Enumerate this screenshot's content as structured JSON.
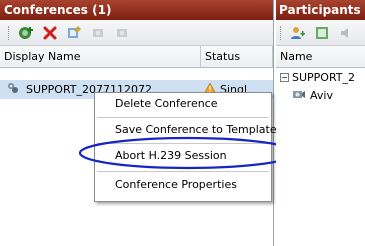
{
  "conferences_panel": {
    "title": "Conferences (1)",
    "columns": [
      "Display Name",
      "Status"
    ],
    "rows": [
      {
        "display_name": "SUPPORT_2077112072",
        "status": "Singl"
      }
    ]
  },
  "context_menu": {
    "items": [
      "Delete Conference",
      "Save Conference to Template",
      "Abort H.239 Session",
      "Conference Properties"
    ]
  },
  "participants_panel": {
    "title": "Participants",
    "columns": [
      "Name"
    ],
    "tree": [
      {
        "label": "SUPPORT_2",
        "expanded": true
      },
      {
        "label": "Aviv"
      }
    ]
  },
  "colors": {
    "title_bar": "#8e2a18",
    "selection": "#cfe0f3",
    "highlight_ellipse": "#1626c4"
  }
}
